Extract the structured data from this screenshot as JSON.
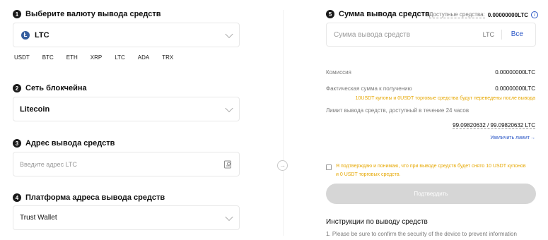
{
  "steps": {
    "currency": {
      "num": "1",
      "title": "Выберите валюту вывода средств",
      "selected_coin": "LTC",
      "coin_icon_letter": "Ł"
    },
    "network": {
      "num": "2",
      "title": "Сеть блокчейна",
      "selected": "Litecoin"
    },
    "address": {
      "num": "3",
      "title": "Адрес вывода средств",
      "placeholder": "Введите адрес LTC"
    },
    "platform": {
      "num": "4",
      "title": "Платформа адреса вывода средств",
      "selected": "Trust Wallet"
    },
    "amount": {
      "num": "5",
      "title": "Сумма вывода средств",
      "available_label": "Доступные средства:",
      "available_value": "0.00000000LTC",
      "info_glyph": "i",
      "placeholder": "Сумма вывода средств",
      "unit": "LTC",
      "all_label": "Все"
    }
  },
  "quick_coins": [
    "USDT",
    "BTC",
    "ETH",
    "XRP",
    "LTC",
    "ADA",
    "TRX"
  ],
  "summary": {
    "fee_label": "Комиссия",
    "fee_value": "0.00000000LTC",
    "received_label": "Фактическая сумма к получению",
    "received_value": "0.00000000LTC",
    "coupon_note": "10USDT купоны и 0USDT торговые средства будут переведены после вывода",
    "limit_label": "Лимит вывода средств, доступный в течение 24 часов",
    "limit_value": "99.09820632 / 99.09820632 LTC",
    "increase_link": "Увеличить лимит",
    "link_arrow": "→"
  },
  "consent": {
    "text_line1": "Я подтверждаю и понимаю, что при выводе средств будет снято 10 USDT купонов",
    "text_line2": "и 0 USDT торговых средств."
  },
  "confirm_label": "Подтвердить",
  "instructions": {
    "title": "Инструкции по выводу средств",
    "item1": "1. Please be sure to confirm the security of the device to prevent information"
  },
  "nav": {
    "arrow_glyph": "→"
  },
  "colors": {
    "accent_link": "#2a56c6",
    "warning": "#e6a700",
    "coin_icon": "#345d9d",
    "button_disabled": "#d6d6d6"
  }
}
